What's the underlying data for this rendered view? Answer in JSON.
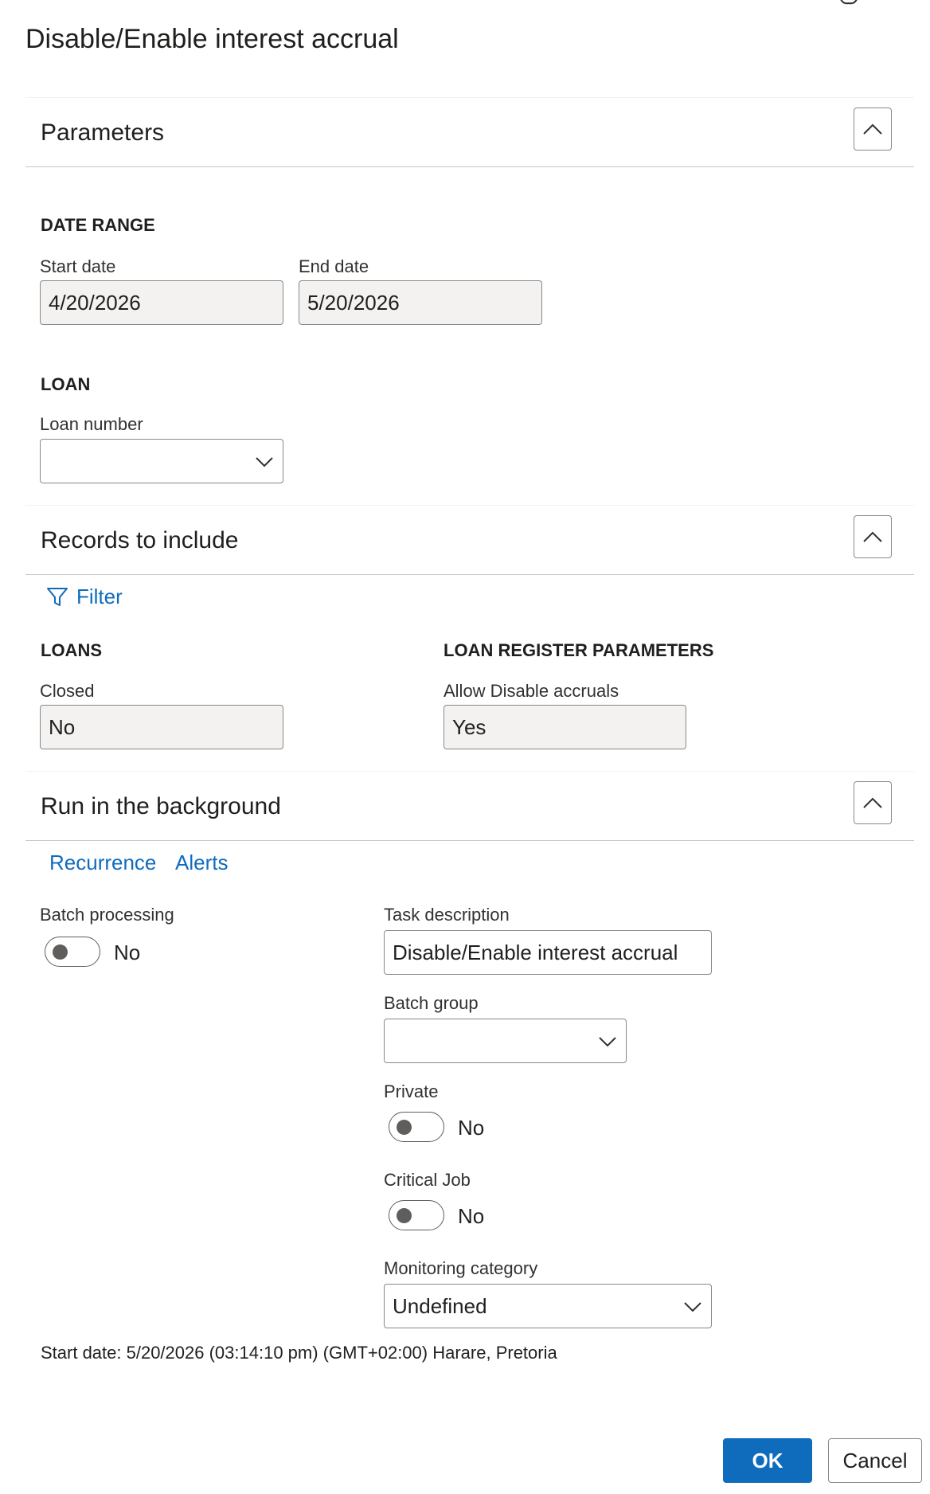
{
  "dialog": {
    "title": "Disable/Enable interest accrual"
  },
  "parameters": {
    "heading": "Parameters",
    "date_range": {
      "group": "DATE RANGE",
      "start_label": "Start date",
      "start_value": "4/20/2026",
      "end_label": "End date",
      "end_value": "5/20/2026"
    },
    "loan": {
      "group": "LOAN",
      "loan_number_label": "Loan number",
      "loan_number_value": ""
    }
  },
  "records": {
    "heading": "Records to include",
    "filter_label": "Filter",
    "loans": {
      "group": "LOANS",
      "closed_label": "Closed",
      "closed_value": "No"
    },
    "register": {
      "group": "LOAN REGISTER PARAMETERS",
      "allow_label": "Allow Disable accruals",
      "allow_value": "Yes"
    }
  },
  "background": {
    "heading": "Run in the background",
    "tabs": [
      "Recurrence",
      "Alerts"
    ],
    "batch_processing_label": "Batch processing",
    "batch_processing_value": "No",
    "task_description_label": "Task description",
    "task_description_value": "Disable/Enable interest accrual",
    "batch_group_label": "Batch group",
    "batch_group_value": "",
    "private_label": "Private",
    "private_value": "No",
    "critical_job_label": "Critical Job",
    "critical_job_value": "No",
    "monitoring_label": "Monitoring category",
    "monitoring_value": "Undefined",
    "start_info": "Start date: 5/20/2026 (03:14:10 pm) (GMT+02:00) Harare, Pretoria"
  },
  "buttons": {
    "ok": "OK",
    "cancel": "Cancel"
  },
  "colors": {
    "accent": "#0f6cbd",
    "readonly_bg": "#f3f2f1",
    "border": "#8a8886"
  },
  "icons": [
    "chevron-up-icon",
    "chevron-down-icon",
    "filter-icon",
    "copilot-icon",
    "more-icon"
  ]
}
